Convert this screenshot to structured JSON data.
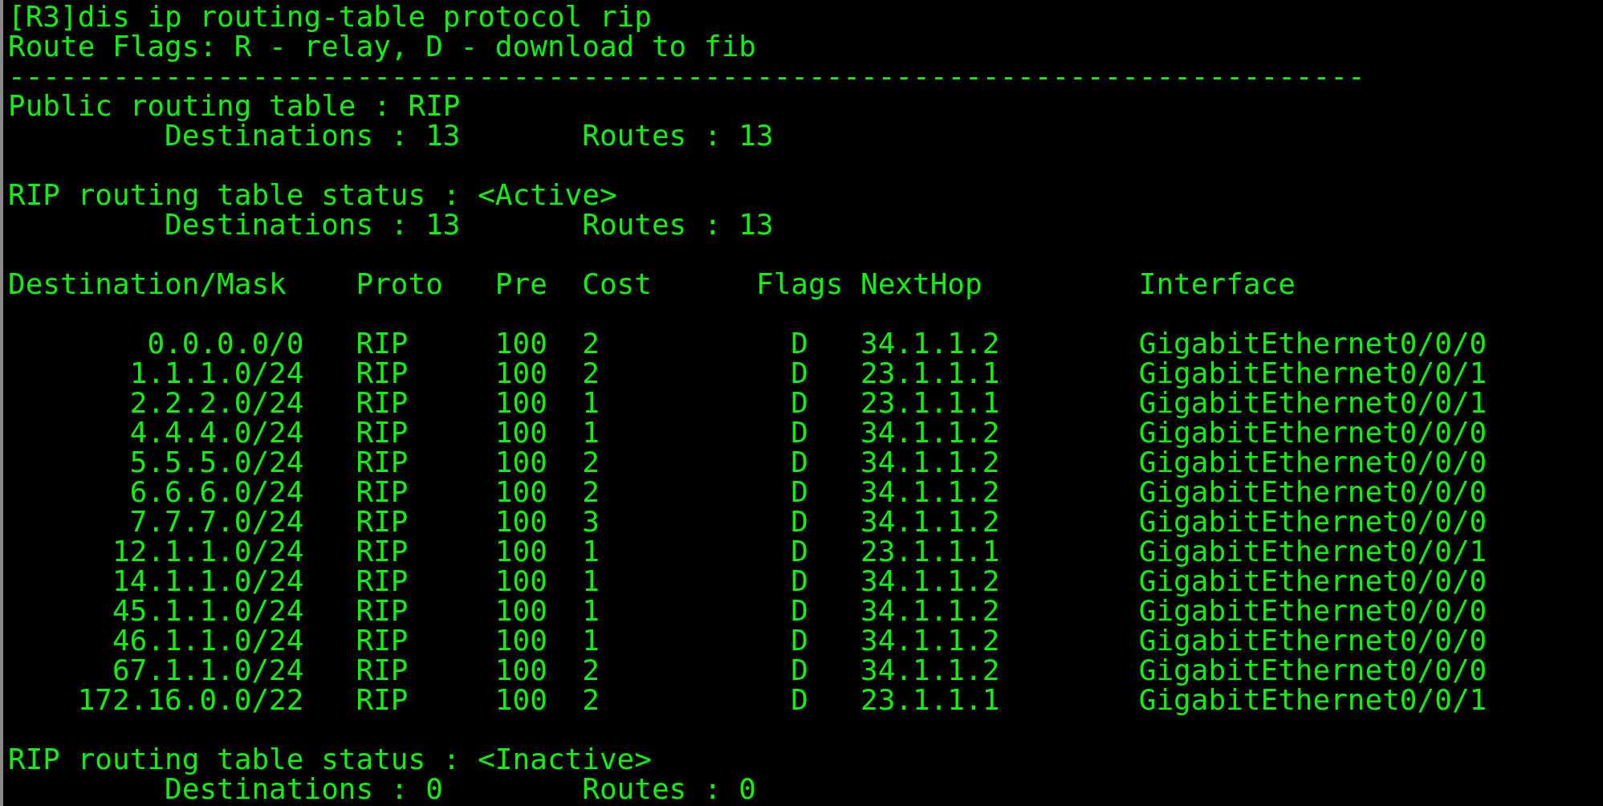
{
  "command": "[R3]dis ip routing-table protocol rip",
  "flags_legend": "Route Flags: R - relay, D - download to fib",
  "separator": "------------------------------------------------------------------------------",
  "public_table": {
    "title": "Public routing table : RIP",
    "destinations": "Destinations : 13",
    "routes": "Routes : 13"
  },
  "active_status": {
    "title": "RIP routing table status : <Active>",
    "destinations": "Destinations : 13",
    "routes": "Routes : 13"
  },
  "table": {
    "columns": [
      "Destination/Mask",
      "Proto",
      "Pre",
      "Cost",
      "Flags",
      "NextHop",
      "Interface"
    ],
    "rows": [
      [
        "0.0.0.0/0",
        "RIP",
        "100",
        "2",
        "D",
        "34.1.1.2",
        "GigabitEthernet0/0/0"
      ],
      [
        "1.1.1.0/24",
        "RIP",
        "100",
        "2",
        "D",
        "23.1.1.1",
        "GigabitEthernet0/0/1"
      ],
      [
        "2.2.2.0/24",
        "RIP",
        "100",
        "1",
        "D",
        "23.1.1.1",
        "GigabitEthernet0/0/1"
      ],
      [
        "4.4.4.0/24",
        "RIP",
        "100",
        "1",
        "D",
        "34.1.1.2",
        "GigabitEthernet0/0/0"
      ],
      [
        "5.5.5.0/24",
        "RIP",
        "100",
        "2",
        "D",
        "34.1.1.2",
        "GigabitEthernet0/0/0"
      ],
      [
        "6.6.6.0/24",
        "RIP",
        "100",
        "2",
        "D",
        "34.1.1.2",
        "GigabitEthernet0/0/0"
      ],
      [
        "7.7.7.0/24",
        "RIP",
        "100",
        "3",
        "D",
        "34.1.1.2",
        "GigabitEthernet0/0/0"
      ],
      [
        "12.1.1.0/24",
        "RIP",
        "100",
        "1",
        "D",
        "23.1.1.1",
        "GigabitEthernet0/0/1"
      ],
      [
        "14.1.1.0/24",
        "RIP",
        "100",
        "1",
        "D",
        "34.1.1.2",
        "GigabitEthernet0/0/0"
      ],
      [
        "45.1.1.0/24",
        "RIP",
        "100",
        "1",
        "D",
        "34.1.1.2",
        "GigabitEthernet0/0/0"
      ],
      [
        "46.1.1.0/24",
        "RIP",
        "100",
        "1",
        "D",
        "34.1.1.2",
        "GigabitEthernet0/0/0"
      ],
      [
        "67.1.1.0/24",
        "RIP",
        "100",
        "2",
        "D",
        "34.1.1.2",
        "GigabitEthernet0/0/0"
      ],
      [
        "172.16.0.0/22",
        "RIP",
        "100",
        "2",
        "D",
        "23.1.1.1",
        "GigabitEthernet0/0/1"
      ]
    ]
  },
  "inactive_status": {
    "title": "RIP routing table status : <Inactive>",
    "destinations": "Destinations : 0",
    "routes": "Routes : 0"
  }
}
